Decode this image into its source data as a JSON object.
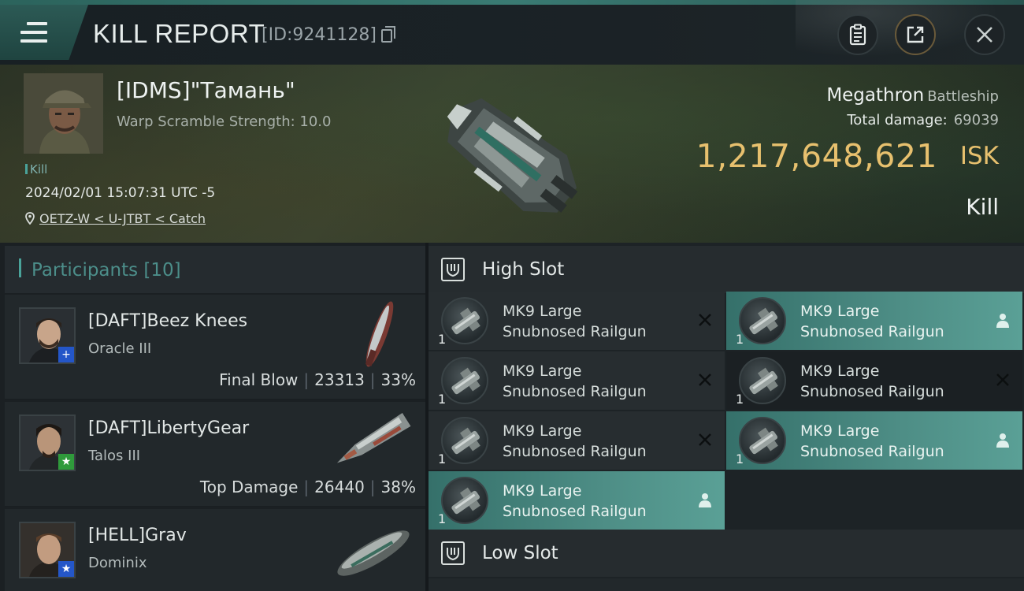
{
  "header": {
    "title": "KILL REPORT",
    "report_id": "[ID:9241128]"
  },
  "victim": {
    "name": "[IDMS]\"Тамань\"",
    "warp_scramble": "Warp Scramble Strength: 10.0",
    "tag": "Kill",
    "datetime": "2024/02/01 15:07:31 UTC -5",
    "location": "OETZ-W < U-JTBT < Catch",
    "ship_name": "Megathron",
    "ship_class": "Battleship",
    "total_damage_label": "Total damage:",
    "total_damage": "69039",
    "isk_value": "1,217,648,621",
    "isk_unit": "ISK",
    "result": "Kill"
  },
  "participants": {
    "title": "Participants [10]",
    "items": [
      {
        "name": "[DAFT]Beez Knees",
        "ship": "Oracle III",
        "role": "Final Blow",
        "damage": "23313",
        "percent": "33%",
        "badge": "+",
        "badge_color": "#2456c8"
      },
      {
        "name": "[DAFT]LibertyGear",
        "ship": "Talos III",
        "role": "Top Damage",
        "damage": "26440",
        "percent": "38%",
        "badge": "★",
        "badge_color": "#2f9a3b"
      },
      {
        "name": "[HELL]Grav",
        "ship": "Dominix",
        "role": "",
        "damage": "",
        "percent": "",
        "badge": "★",
        "badge_color": "#2456c8"
      }
    ]
  },
  "fitting": {
    "high_slot_title": "High Slot",
    "low_slot_title": "Low Slot",
    "high_modules": [
      {
        "line1": "MK9 Large",
        "line2": "Snubnosed Railgun",
        "qty": "1",
        "status": "destroyed"
      },
      {
        "line1": "MK9 Large",
        "line2": "Snubnosed Railgun",
        "qty": "1",
        "status": "dropped"
      },
      {
        "line1": "MK9 Large",
        "line2": "Snubnosed Railgun",
        "qty": "1",
        "status": "destroyed"
      },
      {
        "line1": "MK9 Large",
        "line2": "Snubnosed Railgun",
        "qty": "1",
        "status": "destroyed"
      },
      {
        "line1": "MK9 Large",
        "line2": "Snubnosed Railgun",
        "qty": "1",
        "status": "destroyed"
      },
      {
        "line1": "MK9 Large",
        "line2": "Snubnosed Railgun",
        "qty": "1",
        "status": "dropped"
      },
      {
        "line1": "MK9 Large",
        "line2": "Snubnosed Railgun",
        "qty": "1",
        "status": "dropped"
      }
    ]
  },
  "colors": {
    "accent": "#4aa39a",
    "isk_gold": "#e7c06e",
    "dropped_bg": "#4e8e86"
  }
}
